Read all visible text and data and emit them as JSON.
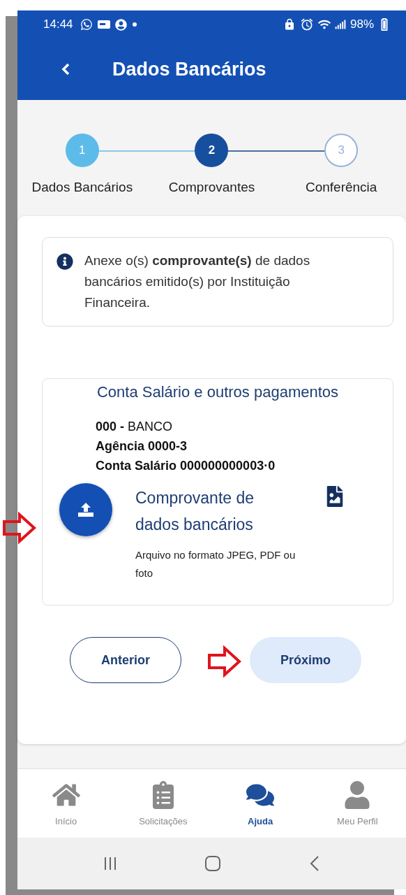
{
  "status_bar": {
    "time": "14:44",
    "battery": "98%"
  },
  "header": {
    "title": "Dados Bancários"
  },
  "steps": [
    {
      "number": "1",
      "label": "Dados Bancários",
      "kind": "done"
    },
    {
      "number": "2",
      "label": "Comprovantes",
      "kind": "current"
    },
    {
      "number": "3",
      "label": "Conferência",
      "kind": "upcoming"
    }
  ],
  "info": {
    "text": "Anexe o(s) **comprovante(s)** de dados bancários emitido(s) por Instituição Financeira."
  },
  "account": {
    "title": "Conta Salário e outros pagamentos",
    "lines": [
      {
        "text": "**000 -** BANCO",
        "bold": false
      },
      {
        "text": "Agência 0000-3",
        "bold": true
      },
      {
        "text": "Conta Salário 000000000003·0",
        "bold": true
      }
    ],
    "upload": {
      "title": "Comprovante de dados bancários",
      "hint": "Arquivo no formato JPEG, PDF ou foto"
    }
  },
  "buttons": [
    {
      "label": "Anterior",
      "kind": "outlined"
    },
    {
      "label": "Próximo",
      "kind": "tonal"
    }
  ],
  "bottom_nav": [
    {
      "label": "Início",
      "selected": false
    },
    {
      "label": "Solicitações",
      "selected": false
    },
    {
      "label": "Ajuda",
      "selected": true
    },
    {
      "label": "Meu Perfil",
      "selected": false
    }
  ]
}
